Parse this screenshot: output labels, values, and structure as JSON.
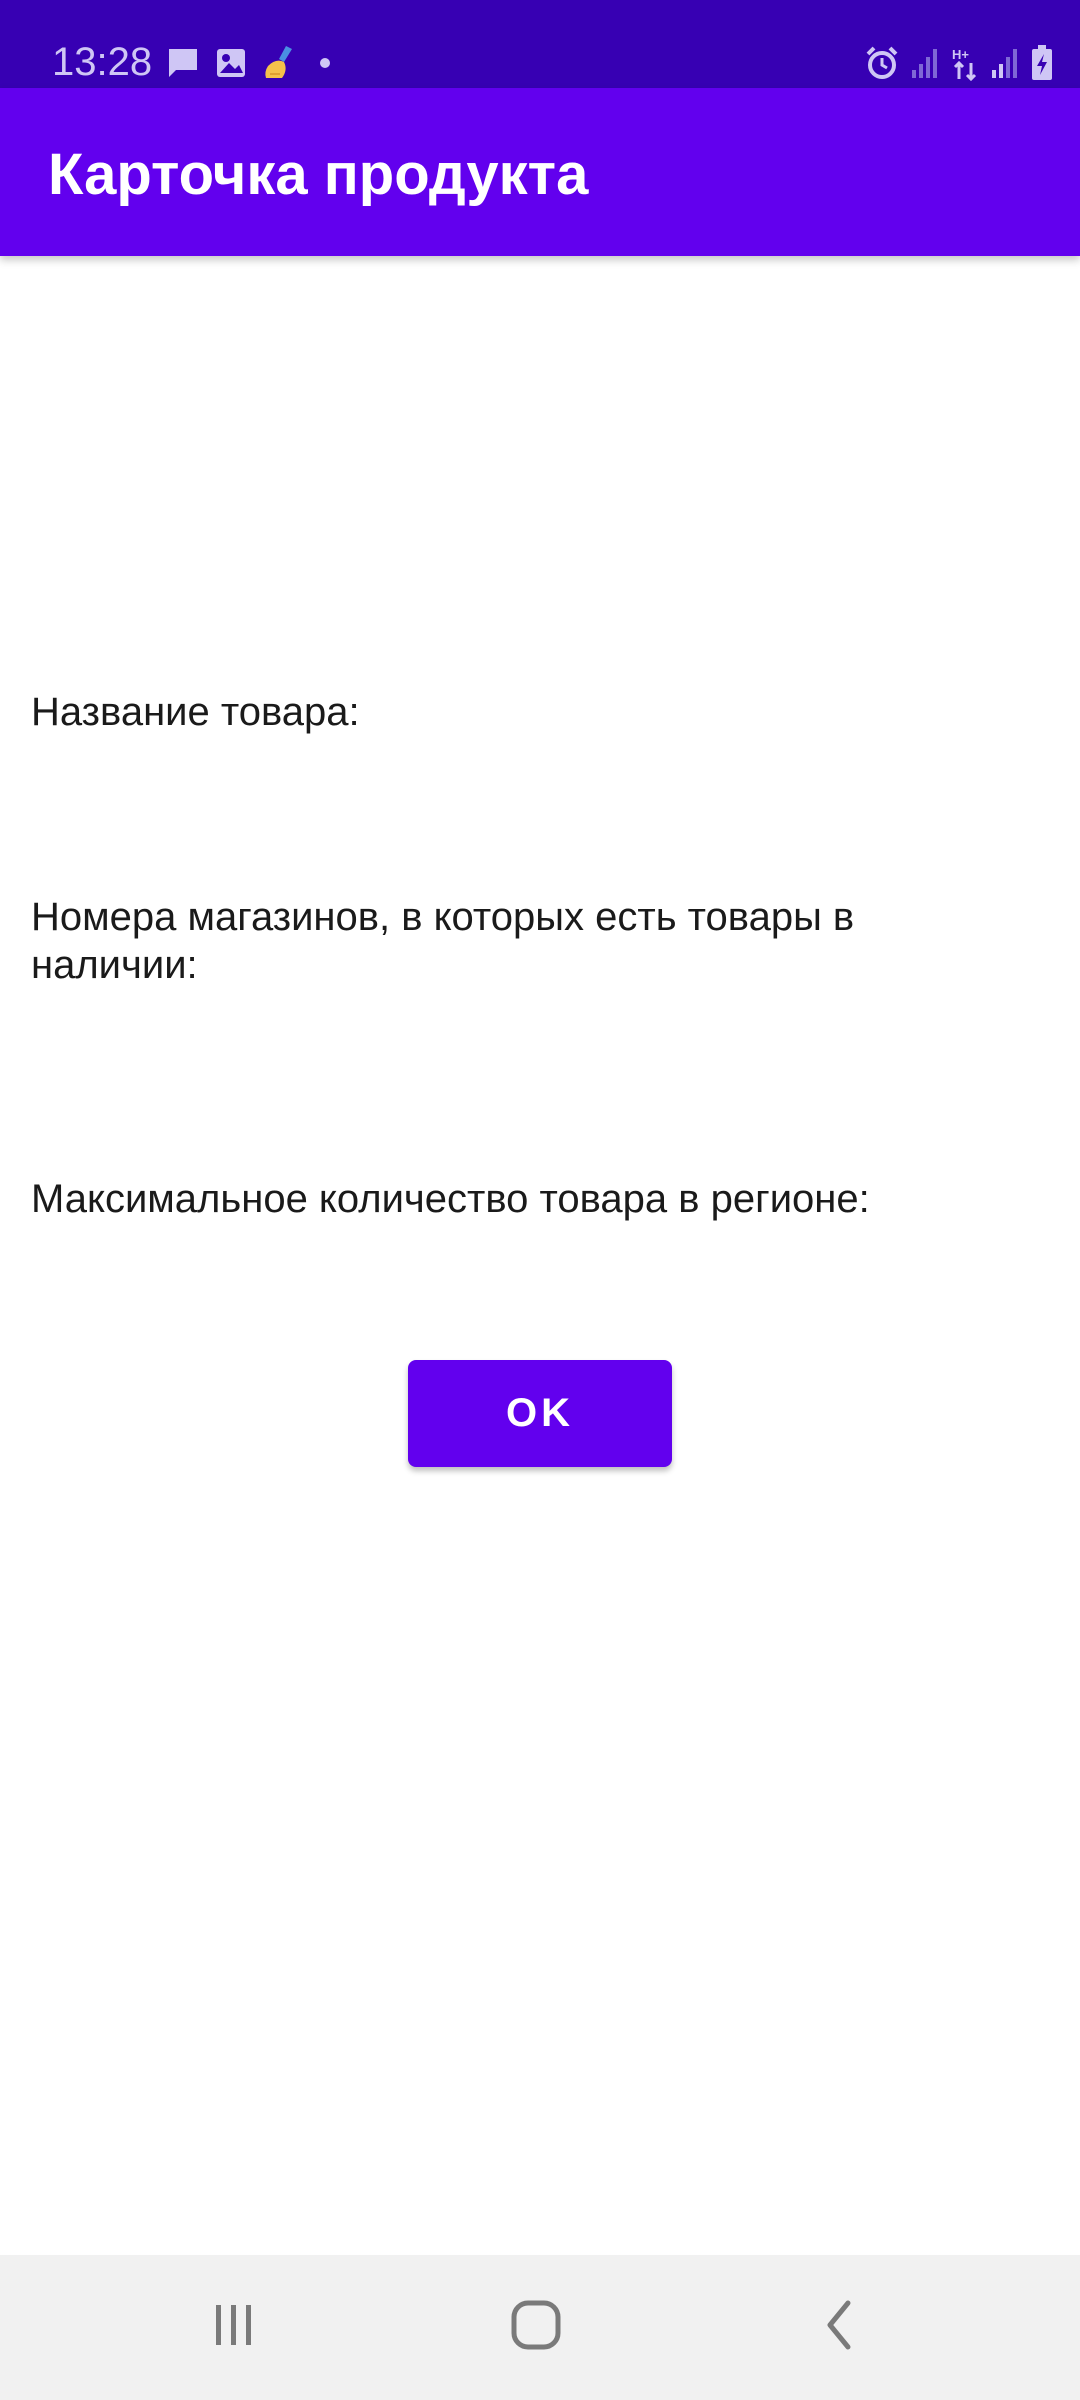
{
  "status_bar": {
    "time": "13:28",
    "left_icons": [
      "message-icon",
      "image-icon",
      "cleaner-app-icon",
      "dot-icon"
    ],
    "right_icons": [
      "alarm-icon",
      "signal-icon",
      "data-transfer-icon",
      "signal-icon",
      "battery-charging-icon"
    ]
  },
  "app_bar": {
    "title": "Карточка продукта"
  },
  "content": {
    "product_name_label": "Название товара:",
    "stores_label": "Номера магазинов, в которых есть товары в наличии:",
    "max_quantity_label": "Максимальное количество товара в регионе:",
    "ok_button_label": "OK"
  },
  "nav_bar": {
    "items": [
      "recents-icon",
      "home-icon",
      "back-icon"
    ]
  },
  "colors": {
    "status_bar": "#3700b3",
    "primary": "#6200ee",
    "nav_bar": "#f1f1f1"
  }
}
